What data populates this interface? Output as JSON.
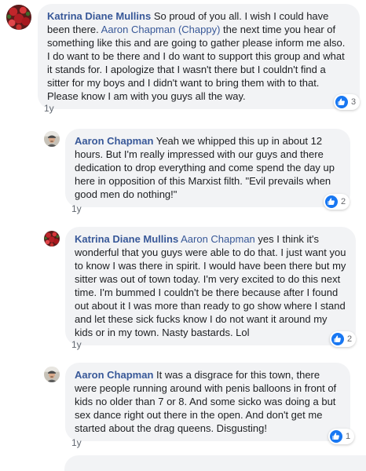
{
  "colors": {
    "author_link": "#385898",
    "bubble_bg": "#f2f3f5",
    "like_blue": "#1877f2",
    "meta_text": "#606770"
  },
  "comments": [
    {
      "author": "Katrina Diane Mullins",
      "avatar_icon": "profile-photo-red-flowers",
      "mention": "",
      "text_before": " So proud of you all. I wish I could have been there. ",
      "inline_mention": "Aaron Chapman (Chappy)",
      "text_after": " the next time you hear of something like this and are going to gather please inform me also. I do want to be there and I do want to support this group and what it stands for. I apologize that I wasn't there but I couldn't find a sitter for my boys and I didn't want to bring them with to that. Please know I am with you guys all the way.",
      "timestamp": "1y",
      "reaction_icon": "like-icon",
      "reaction_count": "3"
    },
    {
      "author": "Aaron Chapman",
      "avatar_icon": "profile-photo-man-hat",
      "text": " Yeah we whipped this up in about 12 hours. But I'm really impressed with our guys and there dedication to drop everything and come spend the day up here in opposition of this Marxist filth. \"Evil prevails when good men do nothing!\"",
      "timestamp": "1y",
      "reaction_icon": "like-icon",
      "reaction_count": "2"
    },
    {
      "author": "Katrina Diane Mullins",
      "avatar_icon": "profile-photo-red-flowers",
      "mention": "Aaron Chapman",
      "text": " yes I think it's wonderful that you guys were able to do that. I just want you to know I was there in spirit. I would have been there but my sitter was out of town today. I'm very excited to do this next time. I'm bummed I couldn't be there because after I found out about it I was more than ready to go show where I stand and let these sick fucks know I do not want it around my kids or in my town. Nasty bastards. Lol",
      "timestamp": "1y",
      "reaction_icon": "like-icon",
      "reaction_count": "2"
    },
    {
      "author": "Aaron Chapman",
      "avatar_icon": "profile-photo-man-hat",
      "text": " It was a disgrace for this town, there were people running around with penis balloons in front of kids no older than 7 or 8. And some sicko was doing a but sex dance right out there in the open. And don't get me started about the drag queens. Disgusting!",
      "timestamp": "1y",
      "reaction_icon": "like-icon",
      "reaction_count": "1"
    }
  ]
}
